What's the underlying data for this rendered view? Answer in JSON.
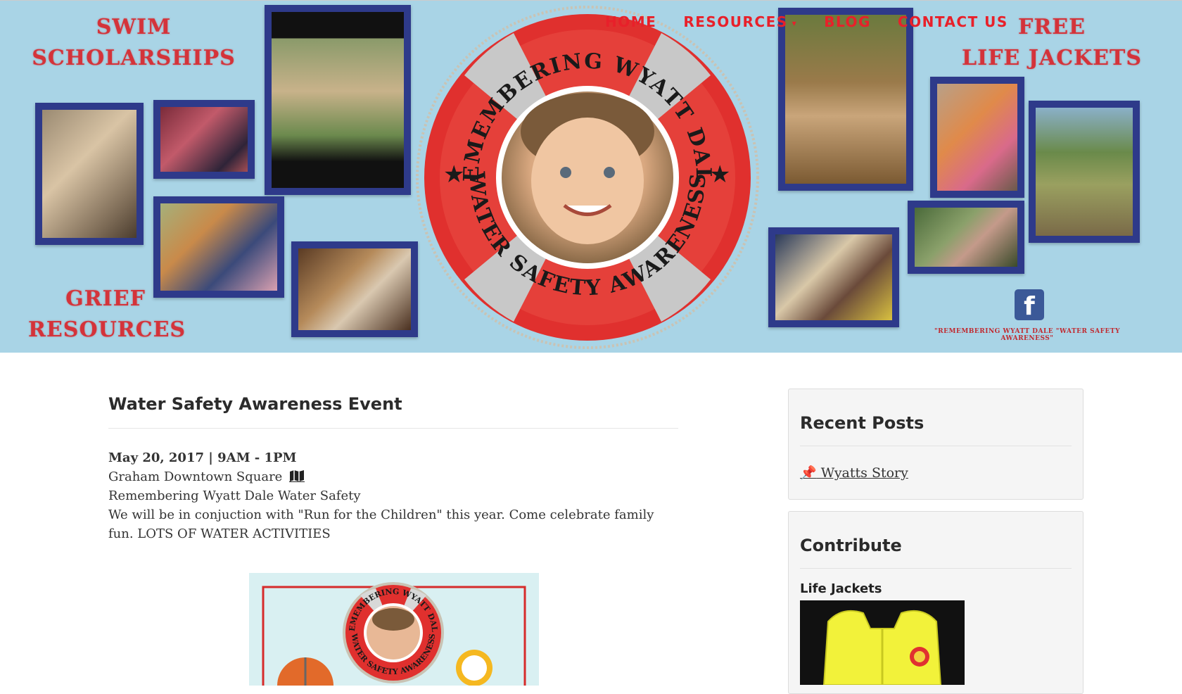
{
  "nav": {
    "items": [
      {
        "label": "HOME"
      },
      {
        "label": "RESOURCES"
      },
      {
        "label": "BLOG"
      },
      {
        "label": "CONTACT US"
      }
    ]
  },
  "banner": {
    "swim": "SWIM\nSCHOLARSHIPS",
    "grief": "GRIEF\nRESOURCES",
    "free": "FREE\nLIFE JACKETS",
    "ring_top": "REMEMBERING WYATT DALE",
    "ring_bottom": "WATER SAFETY AWARENESS",
    "fb_caption": "\"REMEMBERING WYATT DALE \"WATER SAFETY AWARENESS\"",
    "fb_icon": "facebook-icon"
  },
  "post": {
    "title": "Water Safety Awareness Event",
    "date": "May 20, 2017 | 9AM - 1PM",
    "location": "Graham Downtown Square",
    "organizer": "Remembering Wyatt Dale Water Safety",
    "description": "We will be in conjuction with \"Run for the Children\" this year. Come celebrate family fun. LOTS OF WATER ACTIVITIES",
    "flyer_ring_top": "REMEMBERING WYATT DALE",
    "flyer_ring_bottom": "WATER SAFETY AWARENESS"
  },
  "sidebar": {
    "recent": {
      "title": "Recent Posts",
      "items": [
        {
          "label": " Wyatts Story",
          "icon": "pin-icon"
        }
      ]
    },
    "contribute": {
      "title": "Contribute",
      "item_title": "Life Jackets"
    }
  },
  "colors": {
    "banner_bg": "#a9d4e6",
    "accent_red": "#e8202a",
    "frame_blue": "#2e3a8a"
  }
}
